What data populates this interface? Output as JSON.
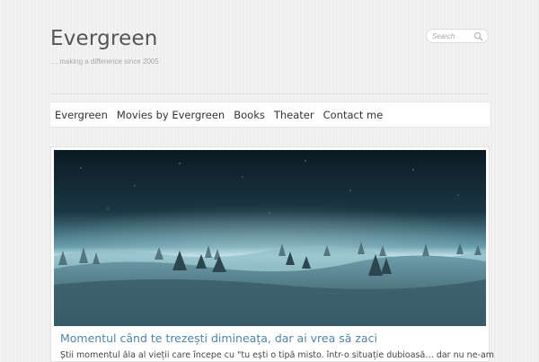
{
  "site": {
    "title": "Evergreen",
    "tagline": "… making a difference since 2005"
  },
  "search": {
    "placeholder": "Search",
    "icon": "search-icon"
  },
  "nav": {
    "items": [
      {
        "label": "Evergreen"
      },
      {
        "label": "Movies by Evergreen"
      },
      {
        "label": "Books"
      },
      {
        "label": "Theater"
      },
      {
        "label": "Contact me"
      }
    ]
  },
  "post": {
    "title": "Momentul când te trezești dimineața, dar ai vrea să zaci",
    "excerpt": "Știi momentul ăla al vieții care începe cu \"tu ești o tipă misto. într-o situație dubioasă… dar nu ne-am",
    "image": "winter-landscape-image"
  },
  "colors": {
    "link": "#4e86a4",
    "background": "#f1f1f1",
    "text": "#555555"
  }
}
